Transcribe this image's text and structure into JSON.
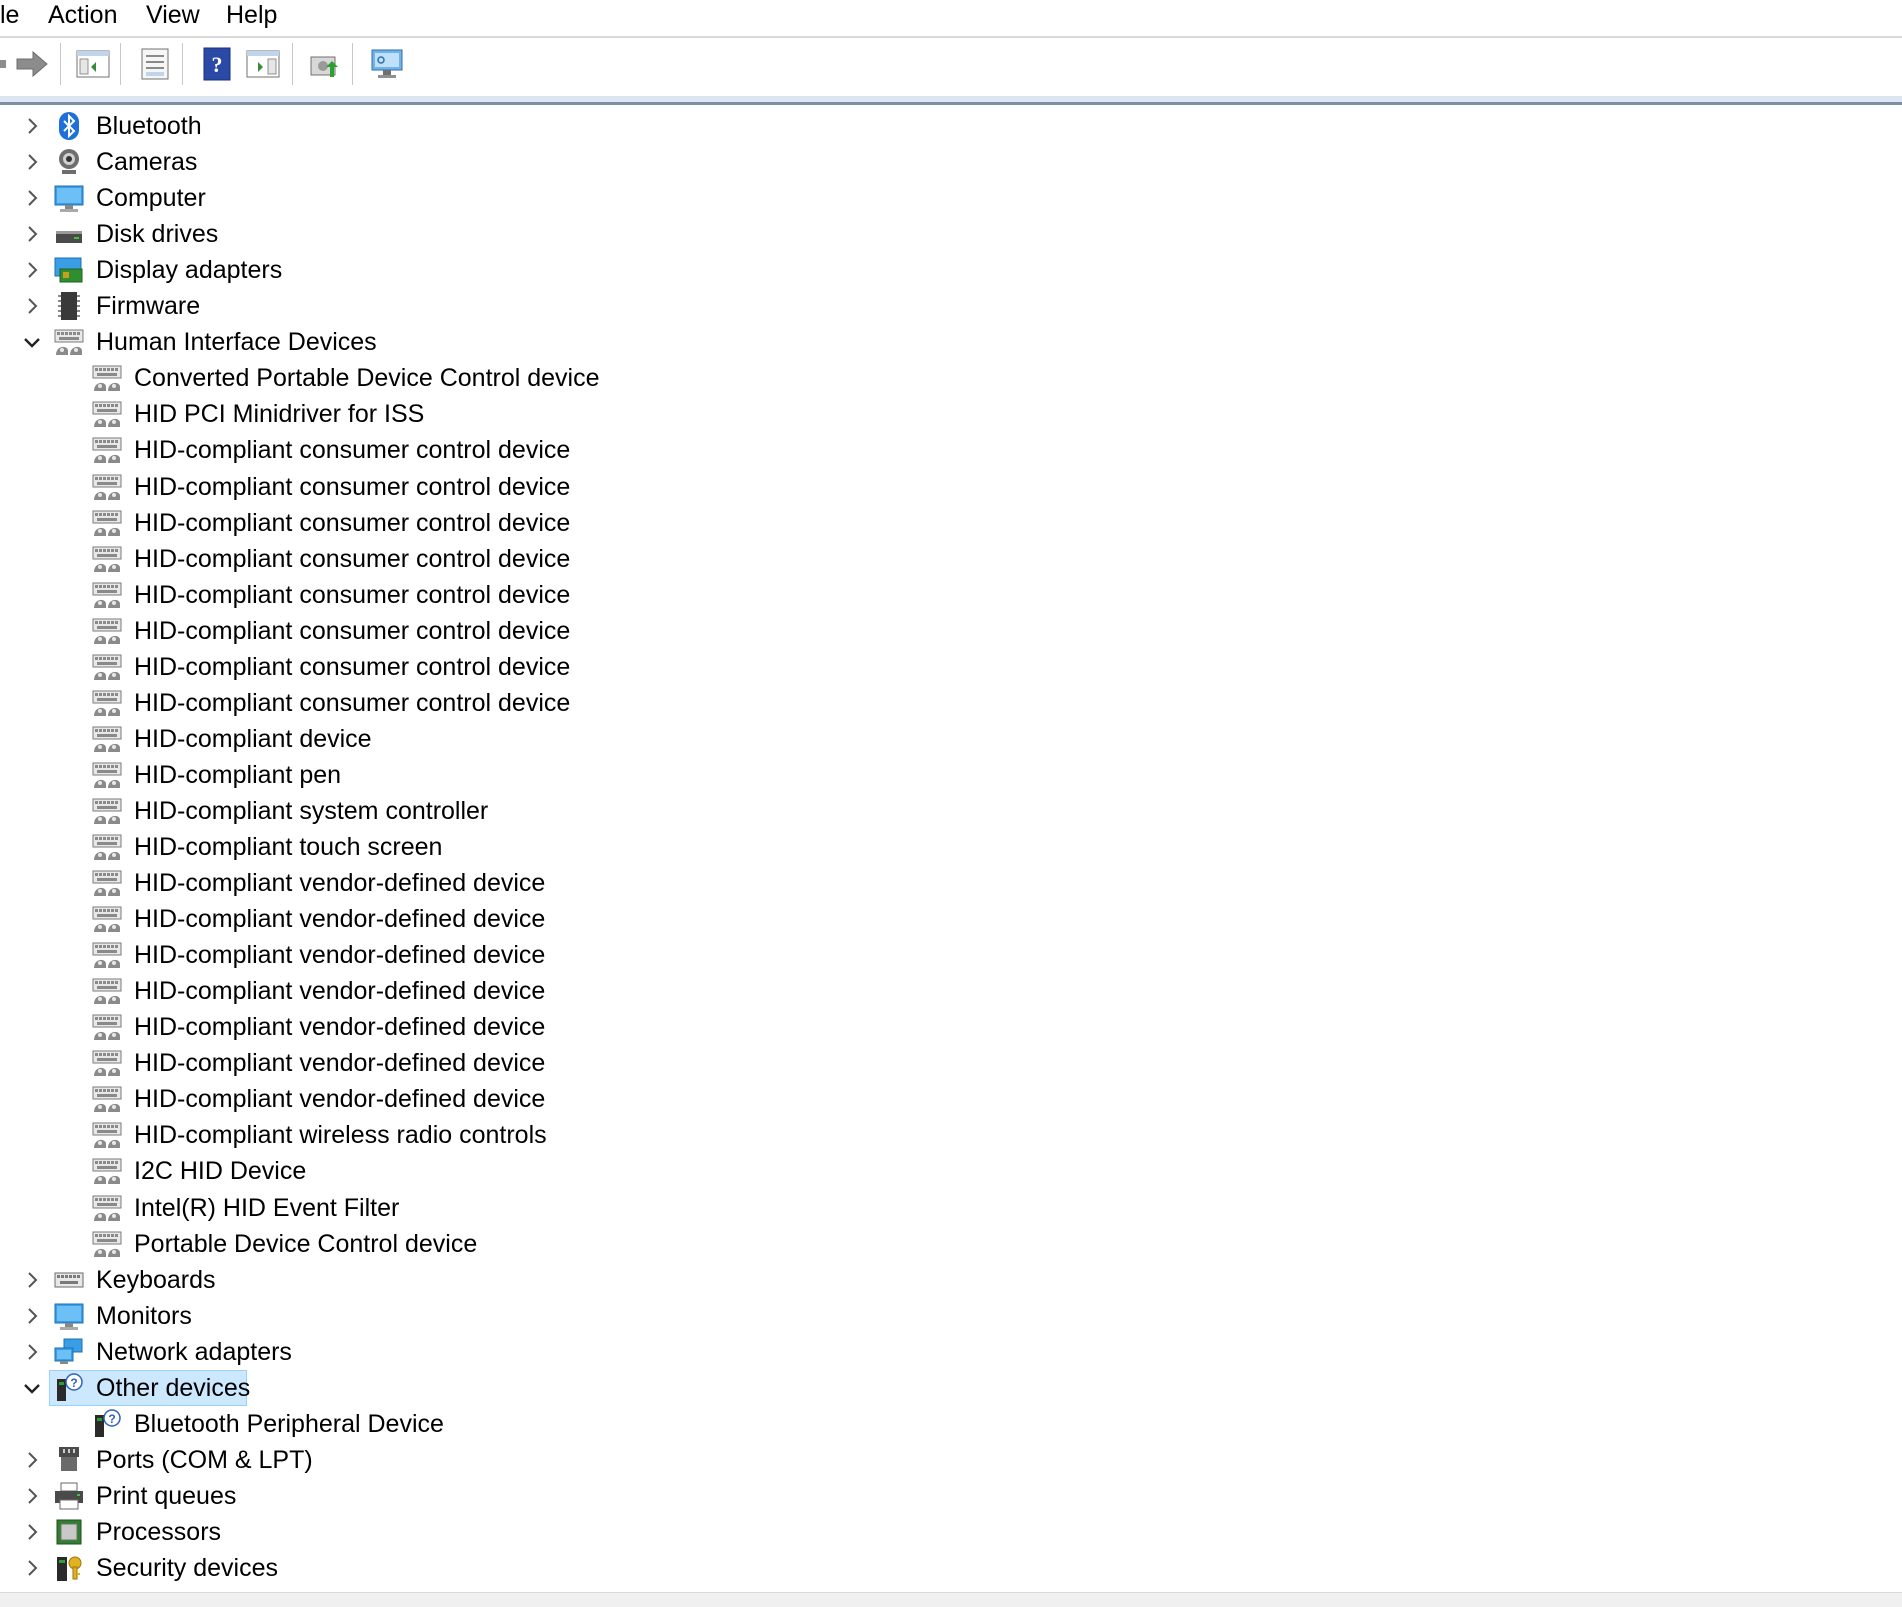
{
  "menu": {
    "items": [
      {
        "label": "le"
      },
      {
        "label": "Action"
      },
      {
        "label": "View"
      },
      {
        "label": "Help"
      }
    ]
  },
  "toolbar": {
    "buttons": [
      {
        "icon": "forward-arrow-icon"
      },
      {
        "icon": "show-hide-console-tree-icon"
      },
      {
        "icon": "properties-icon"
      },
      {
        "icon": "help-icon"
      },
      {
        "icon": "action-pane-icon"
      },
      {
        "icon": "update-driver-icon"
      },
      {
        "icon": "scan-hardware-icon"
      }
    ]
  },
  "tree": {
    "items": [
      {
        "label": "Bluetooth",
        "level": 0,
        "expander": "collapsed",
        "icon": "bluetooth-icon"
      },
      {
        "label": "Cameras",
        "level": 0,
        "expander": "collapsed",
        "icon": "camera-icon"
      },
      {
        "label": "Computer",
        "level": 0,
        "expander": "collapsed",
        "icon": "computer-icon"
      },
      {
        "label": "Disk drives",
        "level": 0,
        "expander": "collapsed",
        "icon": "disk-drive-icon"
      },
      {
        "label": "Display adapters",
        "level": 0,
        "expander": "collapsed",
        "icon": "display-adapter-icon"
      },
      {
        "label": "Firmware",
        "level": 0,
        "expander": "collapsed",
        "icon": "firmware-icon"
      },
      {
        "label": "Human Interface Devices",
        "level": 0,
        "expander": "expanded",
        "icon": "hid-icon"
      },
      {
        "label": "Converted Portable Device Control device",
        "level": 1,
        "icon": "hid-icon"
      },
      {
        "label": "HID PCI Minidriver for ISS",
        "level": 1,
        "icon": "hid-icon"
      },
      {
        "label": "HID-compliant consumer control device",
        "level": 1,
        "icon": "hid-icon"
      },
      {
        "label": "HID-compliant consumer control device",
        "level": 1,
        "icon": "hid-icon"
      },
      {
        "label": "HID-compliant consumer control device",
        "level": 1,
        "icon": "hid-icon"
      },
      {
        "label": "HID-compliant consumer control device",
        "level": 1,
        "icon": "hid-icon"
      },
      {
        "label": "HID-compliant consumer control device",
        "level": 1,
        "icon": "hid-icon"
      },
      {
        "label": "HID-compliant consumer control device",
        "level": 1,
        "icon": "hid-icon"
      },
      {
        "label": "HID-compliant consumer control device",
        "level": 1,
        "icon": "hid-icon"
      },
      {
        "label": "HID-compliant consumer control device",
        "level": 1,
        "icon": "hid-icon"
      },
      {
        "label": "HID-compliant device",
        "level": 1,
        "icon": "hid-icon"
      },
      {
        "label": "HID-compliant pen",
        "level": 1,
        "icon": "hid-icon"
      },
      {
        "label": "HID-compliant system controller",
        "level": 1,
        "icon": "hid-icon"
      },
      {
        "label": "HID-compliant touch screen",
        "level": 1,
        "icon": "hid-icon"
      },
      {
        "label": "HID-compliant vendor-defined device",
        "level": 1,
        "icon": "hid-icon"
      },
      {
        "label": "HID-compliant vendor-defined device",
        "level": 1,
        "icon": "hid-icon"
      },
      {
        "label": "HID-compliant vendor-defined device",
        "level": 1,
        "icon": "hid-icon"
      },
      {
        "label": "HID-compliant vendor-defined device",
        "level": 1,
        "icon": "hid-icon"
      },
      {
        "label": "HID-compliant vendor-defined device",
        "level": 1,
        "icon": "hid-icon"
      },
      {
        "label": "HID-compliant vendor-defined device",
        "level": 1,
        "icon": "hid-icon"
      },
      {
        "label": "HID-compliant vendor-defined device",
        "level": 1,
        "icon": "hid-icon"
      },
      {
        "label": "HID-compliant wireless radio controls",
        "level": 1,
        "icon": "hid-icon"
      },
      {
        "label": "I2C HID Device",
        "level": 1,
        "icon": "hid-icon"
      },
      {
        "label": "Intel(R) HID Event Filter",
        "level": 1,
        "icon": "hid-icon"
      },
      {
        "label": "Portable Device Control device",
        "level": 1,
        "icon": "hid-icon"
      },
      {
        "label": "Keyboards",
        "level": 0,
        "expander": "collapsed",
        "icon": "keyboard-icon"
      },
      {
        "label": "Monitors",
        "level": 0,
        "expander": "collapsed",
        "icon": "monitor-icon"
      },
      {
        "label": "Network adapters",
        "level": 0,
        "expander": "collapsed",
        "icon": "network-adapter-icon"
      },
      {
        "label": "Other devices",
        "level": 0,
        "expander": "expanded",
        "icon": "unknown-device-icon",
        "selected": true
      },
      {
        "label": "Bluetooth Peripheral Device",
        "level": 1,
        "icon": "unknown-device-icon"
      },
      {
        "label": "Ports (COM & LPT)",
        "level": 0,
        "expander": "collapsed",
        "icon": "port-icon"
      },
      {
        "label": "Print queues",
        "level": 0,
        "expander": "collapsed",
        "icon": "printer-icon"
      },
      {
        "label": "Processors",
        "level": 0,
        "expander": "collapsed",
        "icon": "processor-icon"
      },
      {
        "label": "Security devices",
        "level": 0,
        "expander": "collapsed",
        "icon": "security-device-icon"
      }
    ]
  }
}
